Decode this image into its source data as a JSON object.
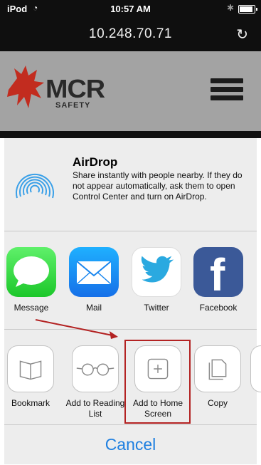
{
  "status_bar": {
    "carrier": "iPod",
    "time": "10:57 AM"
  },
  "browser": {
    "url": "10.248.70.71"
  },
  "site": {
    "logo_main": "MCR",
    "logo_sub": "SAFETY"
  },
  "share_sheet": {
    "airdrop": {
      "title": "AirDrop",
      "description": "Share instantly with people nearby. If they do not appear automatically, ask them to open Control Center and turn on AirDrop."
    },
    "apps": [
      {
        "label": "Message",
        "icon": "message-icon"
      },
      {
        "label": "Mail",
        "icon": "mail-icon"
      },
      {
        "label": "Twitter",
        "icon": "twitter-icon"
      },
      {
        "label": "Facebook",
        "icon": "facebook-icon"
      }
    ],
    "actions": [
      {
        "label": "Bookmark",
        "icon": "bookmark-icon"
      },
      {
        "label": "Add to Reading List",
        "icon": "glasses-icon"
      },
      {
        "label": "Add to Home Screen",
        "icon": "plus-icon"
      },
      {
        "label": "Copy",
        "icon": "copy-icon"
      }
    ],
    "cancel_label": "Cancel"
  },
  "colors": {
    "highlight": "#b32222",
    "cancel": "#1e7fe0"
  }
}
